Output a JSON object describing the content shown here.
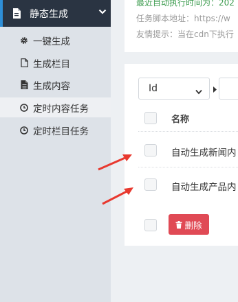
{
  "sidebar": {
    "active_group": {
      "icon": "file-icon",
      "label": "静态生成"
    },
    "items": [
      {
        "icon": "gear-icon",
        "label": "一键生成"
      },
      {
        "icon": "file-outline-icon",
        "label": "生成栏目"
      },
      {
        "icon": "file-text-icon",
        "label": "生成内容"
      },
      {
        "icon": "clock-icon",
        "label": "定时内容任务",
        "selected": true
      },
      {
        "icon": "clock-icon",
        "label": "定时栏目任务"
      }
    ]
  },
  "info": {
    "line1": "最近自动执行时间为：202",
    "line2": "任务脚本地址：https://w",
    "line3": "友情提示：当在cdn下执行"
  },
  "filter": {
    "field_value": "Id"
  },
  "table": {
    "header": "名称",
    "rows": [
      {
        "name": "自动生成新闻内"
      },
      {
        "name": "自动生成产品内"
      }
    ]
  },
  "actions": {
    "delete_label": "删除"
  },
  "colors": {
    "accent": "#2e8fd8",
    "danger": "#e04a55",
    "annotation_arrow": "#e8392f"
  }
}
